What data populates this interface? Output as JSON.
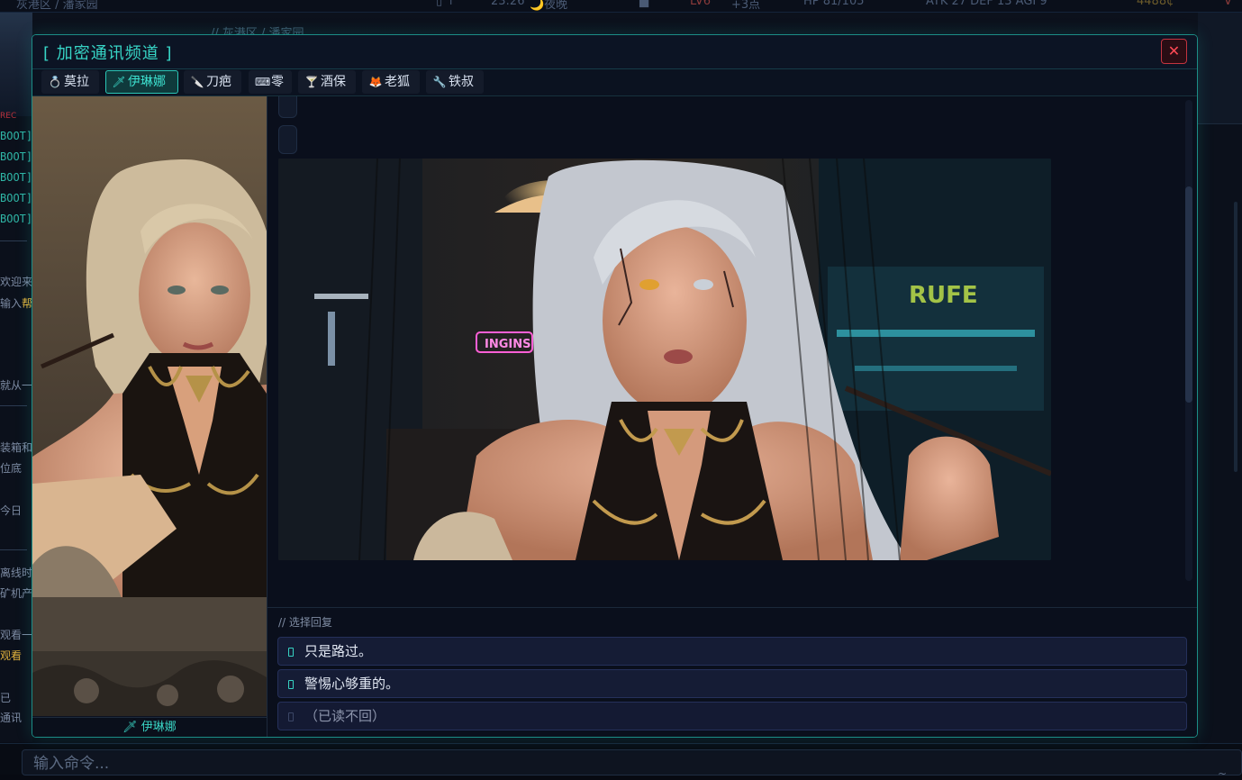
{
  "status_bar": {
    "location": "灰港区 / 潘家园",
    "time": "23:26",
    "period": "🌙夜晚",
    "level": "LV6",
    "points": "+3点",
    "hp": "HP 81/105",
    "stats": "ATK 27 DEF 13 AGI 9",
    "credits": "4488¢",
    "version": "V"
  },
  "background": {
    "breadcrumb": "// 灰港区 / 潘家园",
    "log_lines": [
      "BOOT]",
      "BOOT]",
      "BOOT]",
      "BOOT]",
      "BOOT]"
    ],
    "rec_tag": "REC",
    "fragments": [
      "欢迎来到",
      "输入",
      "帮",
      "就从一旁",
      "装箱和",
      "位底",
      "今日",
      "离线时",
      "矿机产",
      "观看一",
      "观看",
      "已",
      "通讯"
    ]
  },
  "modal": {
    "title": "[ 加密通讯频道 ]",
    "close_label": "✕",
    "tabs": [
      {
        "icon": "💍",
        "label": "莫拉",
        "active": false
      },
      {
        "icon": "🗡",
        "label": "伊琳娜",
        "active": true
      },
      {
        "icon": "🔪",
        "label": "刀疤",
        "active": false
      },
      {
        "icon": "⌨",
        "label": "零",
        "active": false
      },
      {
        "icon": "🍸",
        "label": "酒保",
        "active": false
      },
      {
        "icon": "🦊",
        "label": "老狐",
        "active": false
      },
      {
        "icon": "🔧",
        "label": "铁叔",
        "active": false
      }
    ],
    "portrait_caption": "🗡 伊琳娜",
    "reply_heading": "// 选择回复",
    "replies": [
      {
        "text": "只是路过。",
        "enabled": true
      },
      {
        "text": "警惕心够重的。",
        "enabled": true
      },
      {
        "text": "（已读不回）",
        "enabled": false
      }
    ],
    "image_sign_text": "INGINS"
  },
  "command": {
    "placeholder": "输入命令..."
  },
  "colors": {
    "accent": "#37d5c6",
    "danger": "#ff4a55",
    "panel": "#0a0f1c"
  }
}
